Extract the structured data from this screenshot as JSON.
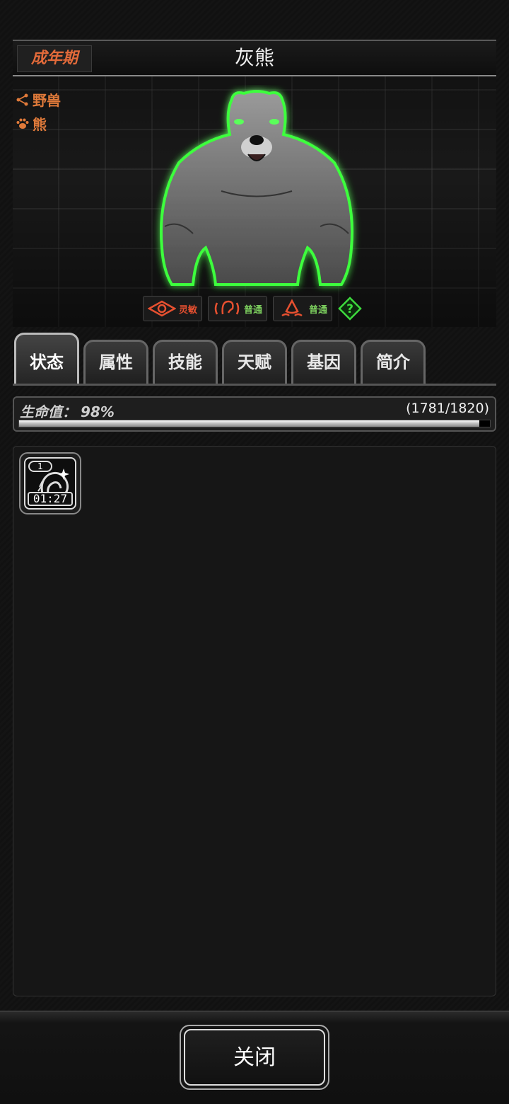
{
  "header": {
    "stage": "成年期",
    "title": "灰熊"
  },
  "tags": [
    {
      "icon": "share-icon",
      "label": "野兽"
    },
    {
      "icon": "paw-icon",
      "label": "熊"
    }
  ],
  "senses": [
    {
      "icon": "eye-icon",
      "label": "灵敏",
      "color": "#e65030"
    },
    {
      "icon": "ear-icon",
      "label": "普通",
      "color": "#7ccf5e"
    },
    {
      "icon": "smell-icon",
      "label": "普通",
      "color": "#7ccf5e"
    }
  ],
  "tabs": [
    "状态",
    "属性",
    "技能",
    "天赋",
    "基因",
    "简介"
  ],
  "active_tab": "状态",
  "health": {
    "label": "生命值：",
    "percent": "98%",
    "value": "(1781/1820)",
    "fraction": 0.978
  },
  "status_effects": [
    {
      "stack": "1",
      "timer": "01:27",
      "icon": "buff-icon"
    }
  ],
  "footer": {
    "close_label": "关闭"
  },
  "colors": {
    "accent_orange": "#e07a3a",
    "glow_green": "#3dff3d"
  }
}
